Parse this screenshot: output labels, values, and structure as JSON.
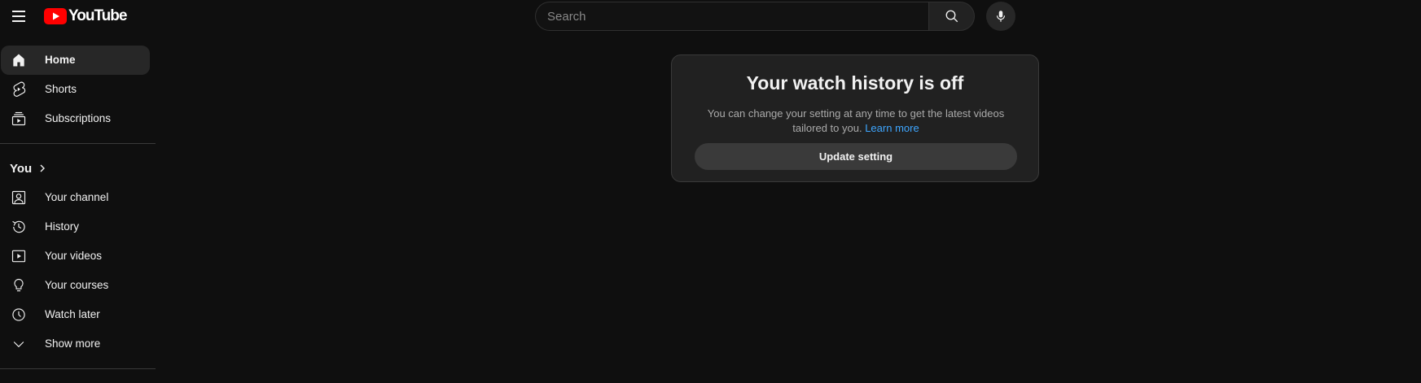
{
  "brand": {
    "logo_text": "YouTube"
  },
  "search": {
    "placeholder": "Search",
    "value": ""
  },
  "sidebar": {
    "items": [
      {
        "label": "Home",
        "icon": "home-icon",
        "active": true
      },
      {
        "label": "Shorts",
        "icon": "shorts-icon"
      },
      {
        "label": "Subscriptions",
        "icon": "subscriptions-icon"
      }
    ],
    "you_section": {
      "title": "You",
      "items": [
        {
          "label": "Your channel",
          "icon": "channel-icon"
        },
        {
          "label": "History",
          "icon": "history-icon"
        },
        {
          "label": "Your videos",
          "icon": "videos-icon"
        },
        {
          "label": "Your courses",
          "icon": "courses-icon"
        },
        {
          "label": "Watch later",
          "icon": "watch-later-icon"
        },
        {
          "label": "Show more",
          "icon": "chevron-down-icon"
        }
      ]
    }
  },
  "history_card": {
    "title": "Your watch history is off",
    "body": "You can change your setting at any time to get the latest videos tailored to you.",
    "link": "Learn more",
    "button": "Update setting"
  },
  "colors": {
    "background": "#0f0f0f",
    "accent": "#ff0000",
    "link": "#3ea6ff"
  }
}
